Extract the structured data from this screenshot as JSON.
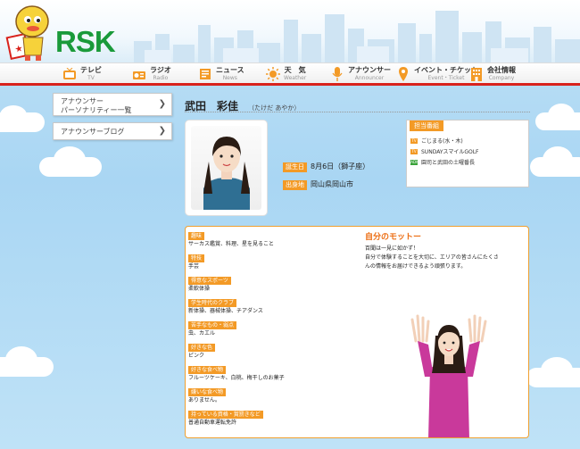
{
  "brand": {
    "logo_text": "RSK",
    "accent": "#d9221c",
    "logo_color": "#1a9a3a",
    "orange": "#f39a26"
  },
  "nav": [
    {
      "jp": "テレビ",
      "en": "TV",
      "icon": "tv-icon"
    },
    {
      "jp": "ラジオ",
      "en": "Radio",
      "icon": "radio-icon"
    },
    {
      "jp": "ニュース",
      "en": "News",
      "icon": "news-icon"
    },
    {
      "jp": "天　気",
      "en": "Weather",
      "icon": "sun-icon"
    },
    {
      "jp": "アナウンサー",
      "en": "Announcer",
      "icon": "microphone-icon"
    },
    {
      "jp": "イベント・チケット",
      "en": "Event・Ticket",
      "icon": "pin-icon"
    },
    {
      "jp": "会社情報",
      "en": "Company",
      "icon": "building-icon"
    }
  ],
  "sidebar": [
    {
      "label_line1": "アナウンサー",
      "label_line2": "パーソナリティー一覧"
    },
    {
      "label_line1": "アナウンサーブログ",
      "label_line2": ""
    }
  ],
  "profile": {
    "name": "武田　彩佳",
    "kana": "（たけだ あやか）",
    "birthday_label": "誕生日",
    "birthday": "8月6日（獅子座）",
    "hometown_label": "出身地",
    "hometown": "岡山県岡山市"
  },
  "programs": {
    "title": "担当番組",
    "items": [
      {
        "text": "ごじまる(水・木)",
        "mark": "TV",
        "color": "#f39a26"
      },
      {
        "text": "SUNDAYスマイルGOLF",
        "mark": "TV",
        "color": "#f39a26"
      },
      {
        "text": "園司と武田の土曜番長",
        "mark": "RADIO",
        "color": "#3aa33a"
      }
    ]
  },
  "details": [
    {
      "q": "趣味",
      "a": "サーカス鑑賞、料理、星を見ること"
    },
    {
      "q": "特技",
      "a": "手芸"
    },
    {
      "q": "得意なスポーツ",
      "a": "柔軟体操"
    },
    {
      "q": "学生時代のクラブ",
      "a": "新体操、器械体操、チアダンス"
    },
    {
      "q": "苦手なもの・弱点",
      "a": "虫、カエル"
    },
    {
      "q": "好きな色",
      "a": "ピンク"
    },
    {
      "q": "好きな食べ物",
      "a": "フルーツケーキ、白桃、梅干しのお菓子"
    },
    {
      "q": "嫌いな食べ物",
      "a": "ありません。"
    },
    {
      "q": "持っている資格・賞罰きなど",
      "a": "普通自動車運転免許"
    }
  ],
  "motto": {
    "title": "自分のモットー",
    "lines": [
      "百聞は一見に如かず！",
      "自分で体験することを大切に、エリアの皆さんにたくさ",
      "んの情報をお届けできるよう頑張ります。"
    ]
  }
}
